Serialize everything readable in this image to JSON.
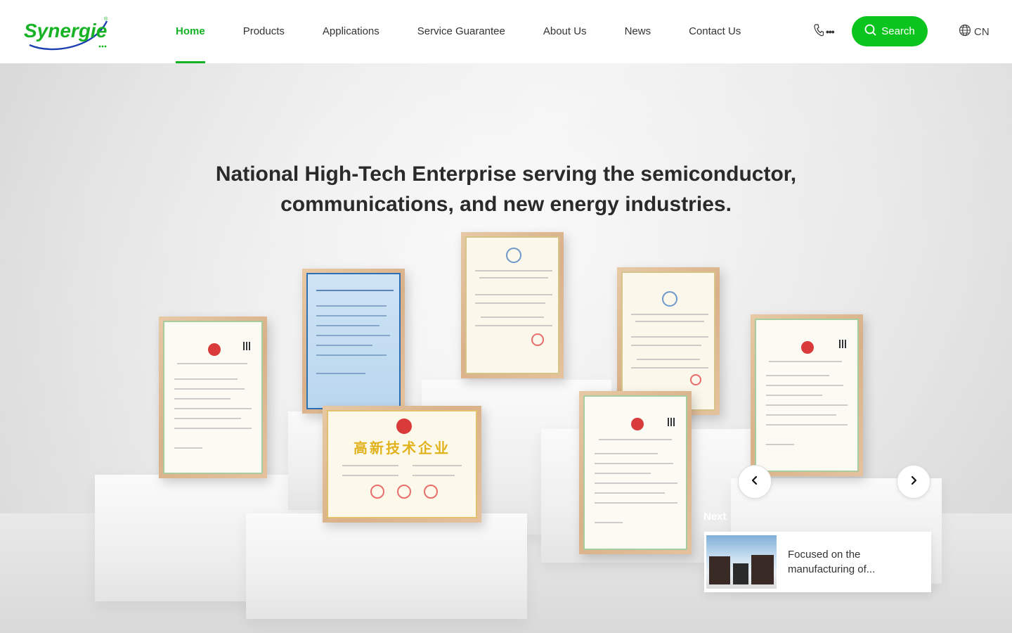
{
  "brand": {
    "name": "Synergie",
    "color": "#12b224"
  },
  "nav": {
    "items": [
      {
        "label": "Home",
        "active": true
      },
      {
        "label": "Products",
        "active": false
      },
      {
        "label": "Applications",
        "active": false
      },
      {
        "label": "Service Guarantee",
        "active": false
      },
      {
        "label": "About Us",
        "active": false
      },
      {
        "label": "News",
        "active": false
      },
      {
        "label": "Contact Us",
        "active": false
      }
    ]
  },
  "header": {
    "phone_icon": "phone-icon",
    "phone_more": "•••",
    "search_label": "Search",
    "search_icon": "search-icon",
    "lang_icon": "globe-icon",
    "lang_label": "CN"
  },
  "hero": {
    "title_line1": "National High-Tech Enterprise serving the semiconductor,",
    "title_line2": "communications, and new energy industries.",
    "certificates": {
      "center_gold": "高新技术企业"
    }
  },
  "carousel": {
    "prev_icon": "chevron-left-icon",
    "next_icon": "chevron-right-icon",
    "next_label": "Next",
    "next_card_text": "Focused on the manufacturing of..."
  },
  "colors": {
    "accent": "#0bc41d",
    "text": "#2a2a2a"
  }
}
